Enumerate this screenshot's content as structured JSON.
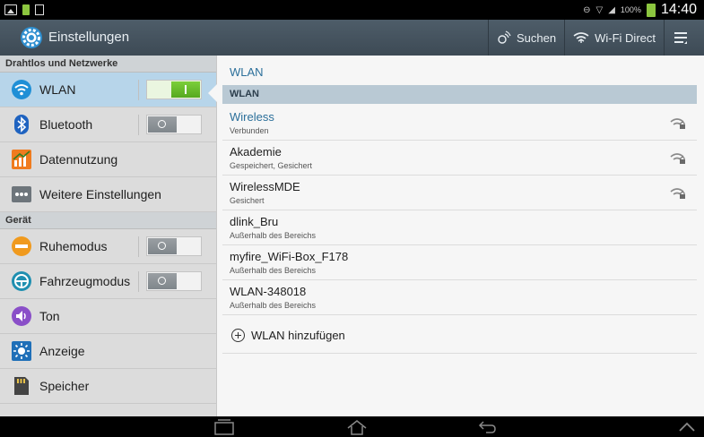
{
  "status_bar": {
    "battery_percent": "100%",
    "time": "14:40"
  },
  "action_bar": {
    "title": "Einstellungen",
    "search_label": "Suchen",
    "wifi_direct_label": "Wi-Fi Direct"
  },
  "sidebar": {
    "categories": [
      {
        "label": "Drahtlos und Netzwerke"
      },
      {
        "label": "Gerät"
      }
    ],
    "items": [
      {
        "label": "WLAN",
        "toggle": "on",
        "selected": true
      },
      {
        "label": "Bluetooth",
        "toggle": "off"
      },
      {
        "label": "Datennutzung"
      },
      {
        "label": "Weitere Einstellungen"
      },
      {
        "label": "Ruhemodus",
        "toggle": "off"
      },
      {
        "label": "Fahrzeugmodus",
        "toggle": "off"
      },
      {
        "label": "Ton"
      },
      {
        "label": "Anzeige"
      },
      {
        "label": "Speicher"
      }
    ]
  },
  "main": {
    "heading": "WLAN",
    "section_label": "WLAN",
    "networks": [
      {
        "name": "Wireless",
        "status": "Verbunden",
        "secured_signal": true,
        "connected": true
      },
      {
        "name": "Akademie",
        "status": "Gespeichert, Gesichert",
        "secured_signal": true
      },
      {
        "name": "WirelessMDE",
        "status": "Gesichert",
        "secured_signal": true
      },
      {
        "name": "dlink_Bru",
        "status": "Außerhalb des Bereichs"
      },
      {
        "name": "myfire_WiFi-Box_F178",
        "status": "Außerhalb des Bereichs"
      },
      {
        "name": "WLAN-348018",
        "status": "Außerhalb des Bereichs"
      }
    ],
    "add_label": "WLAN hinzufügen"
  },
  "colors": {
    "action_bar": "#46545f",
    "accent_blue": "#2b6f9a",
    "toggle_on": "#62b52a",
    "selected_item": "#b7d5ea"
  }
}
